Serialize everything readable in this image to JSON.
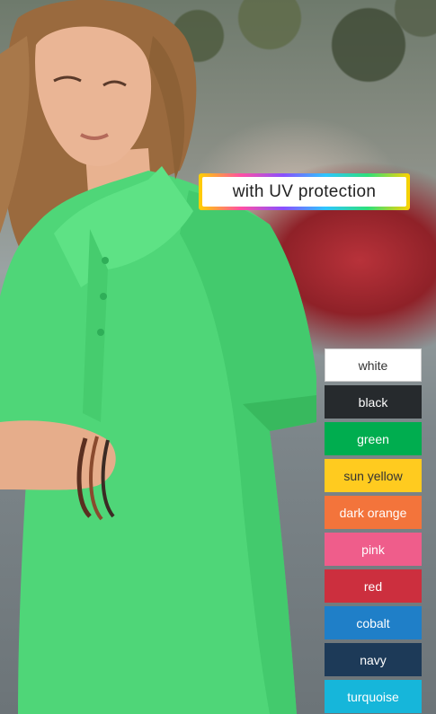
{
  "banner": {
    "text": "with UV protection"
  },
  "colors": [
    {
      "label": "white",
      "hex": "#ffffff",
      "text": "#333333"
    },
    {
      "label": "black",
      "hex": "#262a2d",
      "text": "#ffffff"
    },
    {
      "label": "green",
      "hex": "#00ad4f",
      "text": "#ffffff"
    },
    {
      "label": "sun yellow",
      "hex": "#ffcb1f",
      "text": "#333333"
    },
    {
      "label": "dark orange",
      "hex": "#f3743b",
      "text": "#ffffff"
    },
    {
      "label": "pink",
      "hex": "#ef5d8b",
      "text": "#ffffff"
    },
    {
      "label": "red",
      "hex": "#cc2f3e",
      "text": "#ffffff"
    },
    {
      "label": "cobalt",
      "hex": "#1f7fc8",
      "text": "#ffffff"
    },
    {
      "label": "navy",
      "hex": "#1d3a58",
      "text": "#ffffff"
    },
    {
      "label": "turquoise",
      "hex": "#16b6da",
      "text": "#ffffff"
    }
  ]
}
